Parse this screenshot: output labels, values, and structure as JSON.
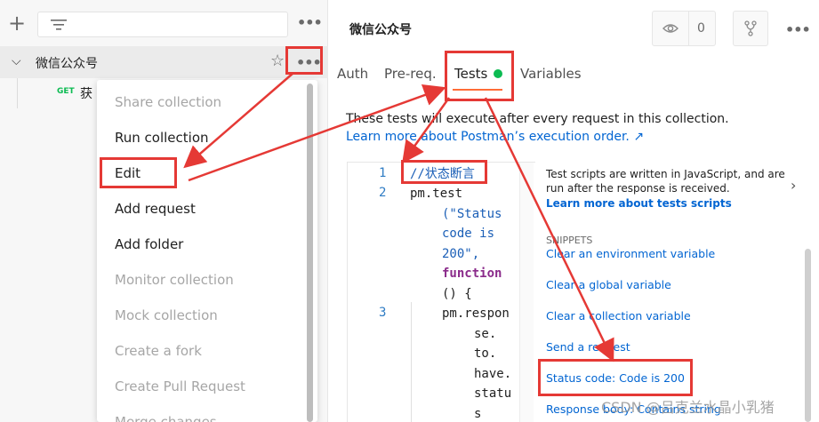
{
  "sidebar": {
    "collection_name": "微信公众号",
    "request_method": "GET",
    "request_name": "获"
  },
  "context_menu": {
    "items": [
      {
        "label": "Share collection",
        "enabled": false
      },
      {
        "label": "Run collection",
        "enabled": true
      },
      {
        "label": "Edit",
        "enabled": true
      },
      {
        "label": "Add request",
        "enabled": true
      },
      {
        "label": "Add folder",
        "enabled": true
      },
      {
        "label": "Monitor collection",
        "enabled": false
      },
      {
        "label": "Mock collection",
        "enabled": false
      },
      {
        "label": "Create a fork",
        "enabled": false
      },
      {
        "label": "Create Pull Request",
        "enabled": false
      },
      {
        "label": "Merge changes",
        "enabled": false
      }
    ]
  },
  "header": {
    "title": "微信公众号",
    "watch_count": "0"
  },
  "tabs": [
    {
      "label": "Auth"
    },
    {
      "label": "Pre-req."
    },
    {
      "label": "Tests"
    },
    {
      "label": "Variables"
    }
  ],
  "tests": {
    "description": "These tests will execute after every request in this collection.",
    "learn_link": "Learn more about Postman’s execution order. ↗"
  },
  "editor": {
    "line_numbers": [
      "1",
      "2",
      "3"
    ],
    "comment": "//状态断言",
    "test_call": "pm.test",
    "status_str_1": "(\"Status",
    "status_str_2": "code is",
    "status_str_3": "200\",",
    "function_kw": "function",
    "parens": "() {",
    "response_line": "pm.respon",
    "chain": [
      "se.",
      "to.",
      "have.",
      "statu",
      "s"
    ]
  },
  "snippets": {
    "info": "Test scripts are written in JavaScript, and are run after the response is received.",
    "learn_link": "Learn more about tests scripts",
    "heading": "SNIPPETS",
    "items": [
      "Clear an environment variable",
      "Clear a global variable",
      "Clear a collection variable",
      "Send a request",
      "Status code: Code is 200",
      "Response body: Contains string"
    ]
  },
  "watermark": "CSDN @吕克兰水晶小乳猪",
  "colors": {
    "annotation_red": "#e53935",
    "tab_accent": "#ff6c37",
    "status_green": "#0cbb52",
    "link_blue": "#0265d2"
  }
}
